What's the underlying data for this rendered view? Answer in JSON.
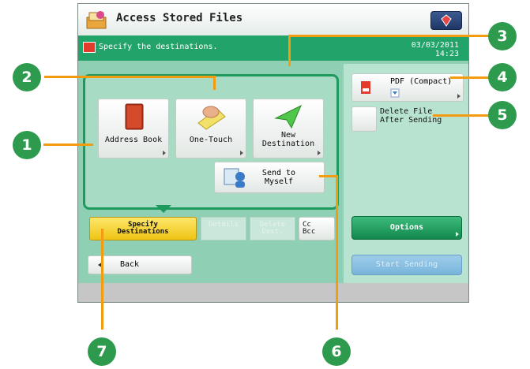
{
  "header": {
    "title": "Access Stored Files"
  },
  "message": {
    "text": "Specify the destinations.",
    "date": "03/03/2011",
    "time": "14:23"
  },
  "buttons": {
    "address_book": "Address Book",
    "one_touch": "One-Touch",
    "new_destination_1": "New",
    "new_destination_2": "Destination",
    "send_to_myself_1": "Send to",
    "send_to_myself_2": "Myself"
  },
  "tabs": {
    "specify_1": "Specify",
    "specify_2": "Destinations",
    "details": "Details",
    "delete_1": "Delete",
    "delete_2": "Dest.",
    "cc": "Cc",
    "bcc": "Bcc"
  },
  "back_label": "Back",
  "right": {
    "pdf_label": "PDF (Compact)",
    "delete_file_1": "Delete File",
    "delete_file_2": "After Sending",
    "options_label": "Options",
    "start_label": "Start Sending"
  },
  "callouts": [
    "1",
    "2",
    "3",
    "4",
    "5",
    "6",
    "7"
  ],
  "colors": {
    "accent": "#22a36a",
    "callout": "#2d9a4d",
    "leader": "#f39c12",
    "selected_tab": "#f5cf1e"
  }
}
